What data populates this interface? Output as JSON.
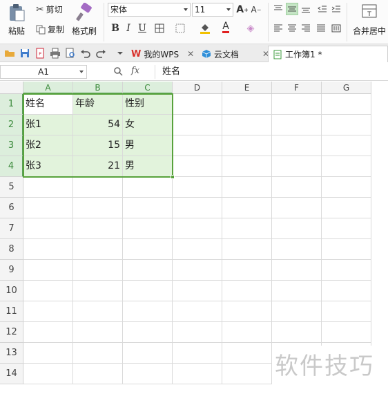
{
  "ribbon": {
    "paste_label": "粘贴",
    "cut_label": "剪切",
    "copy_label": "复制",
    "format_painter_label": "格式刷",
    "font_name": "宋体",
    "font_size": "11",
    "bold": "B",
    "italic": "I",
    "underline": "U",
    "merge_center_label": "合并居中"
  },
  "tabs": [
    {
      "label": "我的WPS",
      "closable": true
    },
    {
      "label": "云文档",
      "closable": true
    },
    {
      "label": "工作簿1 *",
      "active": true
    }
  ],
  "formula_bar": {
    "name_box": "A1",
    "fx": "fx",
    "content": "姓名"
  },
  "columns": [
    "A",
    "B",
    "C",
    "D",
    "E",
    "F",
    "G"
  ],
  "rows": [
    "1",
    "2",
    "3",
    "4",
    "5",
    "6",
    "7",
    "8",
    "9",
    "10",
    "11",
    "12",
    "13",
    "14"
  ],
  "cells": [
    [
      "姓名",
      "年龄",
      "性别"
    ],
    [
      "张1",
      "54",
      "女"
    ],
    [
      "张2",
      "15",
      "男"
    ],
    [
      "张3",
      "21",
      "男"
    ]
  ],
  "selection": "A1:C4",
  "colors": {
    "selection_border": "#58a23c",
    "selection_fill": "#e2f3dc",
    "header_selected": "#dceedc"
  },
  "watermark": "软件技巧"
}
